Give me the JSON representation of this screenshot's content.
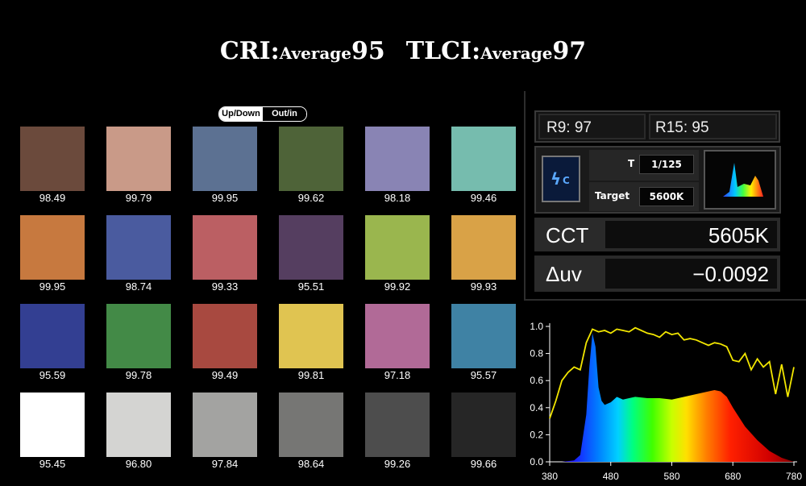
{
  "title": {
    "cri_label": "CRI:",
    "cri_avg_word": "Average",
    "cri_value": "95",
    "tlci_label": "TLCI:",
    "tlci_avg_word": "Average",
    "tlci_value": "97"
  },
  "toggle": {
    "left": "Up/Down",
    "right": "Out/in"
  },
  "swatches": [
    {
      "color": "#6b4a3c",
      "value": "98.49"
    },
    {
      "color": "#c99a88",
      "value": "99.79"
    },
    {
      "color": "#5c7192",
      "value": "99.95"
    },
    {
      "color": "#4e6338",
      "value": "99.62"
    },
    {
      "color": "#8984b4",
      "value": "98.18"
    },
    {
      "color": "#76bcae",
      "value": "99.46"
    },
    {
      "color": "#c7793f",
      "value": "99.95"
    },
    {
      "color": "#4a5b9f",
      "value": "98.74"
    },
    {
      "color": "#bb5f63",
      "value": "99.33"
    },
    {
      "color": "#553e60",
      "value": "95.51"
    },
    {
      "color": "#9ab64e",
      "value": "99.92"
    },
    {
      "color": "#d9a247",
      "value": "99.93"
    },
    {
      "color": "#333f92",
      "value": "95.59"
    },
    {
      "color": "#438a47",
      "value": "99.78"
    },
    {
      "color": "#a84940",
      "value": "99.49"
    },
    {
      "color": "#e0c451",
      "value": "99.81"
    },
    {
      "color": "#b16a97",
      "value": "97.18"
    },
    {
      "color": "#3f82a4",
      "value": "95.57"
    },
    {
      "color": "#ffffff",
      "value": "95.45"
    },
    {
      "color": "#d4d4d2",
      "value": "96.80"
    },
    {
      "color": "#a3a3a1",
      "value": "97.84"
    },
    {
      "color": "#767674",
      "value": "98.64"
    },
    {
      "color": "#4d4d4d",
      "value": "99.26"
    },
    {
      "color": "#262626",
      "value": "99.66"
    }
  ],
  "meter": {
    "r9": "R9: 97",
    "r15": "R15: 95",
    "mode_icon": "flash-c-icon",
    "t_label": "T",
    "t_value": "1/125",
    "target_label": "Target",
    "target_value": "5600K",
    "spectrum_icon": "spectrum-thumbnail-icon",
    "cct_label": "CCT",
    "cct_value": "5605K",
    "duv_label": "Δuv",
    "duv_value": "−0.0092"
  },
  "chart_data": {
    "type": "area",
    "x_ticks": [
      "380",
      "480",
      "580",
      "680",
      "780"
    ],
    "y_ticks": [
      "0.0",
      "0.2",
      "0.4",
      "0.6",
      "0.8",
      "1.0"
    ],
    "xlim": [
      380,
      780
    ],
    "ylim": [
      0,
      1.0
    ],
    "series": [
      {
        "kind": "spectral-power-area",
        "x": [
          380,
          400,
          420,
          430,
          440,
          445,
          450,
          455,
          460,
          465,
          470,
          480,
          490,
          500,
          510,
          520,
          540,
          560,
          580,
          600,
          620,
          640,
          650,
          660,
          670,
          680,
          700,
          720,
          740,
          760,
          780
        ],
        "y": [
          0.0,
          0.0,
          0.01,
          0.05,
          0.35,
          0.7,
          0.95,
          0.85,
          0.55,
          0.45,
          0.42,
          0.44,
          0.48,
          0.46,
          0.47,
          0.48,
          0.47,
          0.47,
          0.46,
          0.48,
          0.5,
          0.52,
          0.53,
          0.52,
          0.48,
          0.4,
          0.26,
          0.16,
          0.08,
          0.03,
          0.0
        ]
      },
      {
        "kind": "line",
        "color": "#f2e600",
        "x": [
          380,
          390,
          400,
          410,
          420,
          430,
          440,
          450,
          460,
          470,
          480,
          490,
          500,
          510,
          520,
          530,
          540,
          550,
          560,
          570,
          580,
          590,
          600,
          610,
          620,
          630,
          640,
          650,
          660,
          670,
          680,
          690,
          700,
          710,
          720,
          730,
          740,
          750,
          760,
          770,
          780
        ],
        "y": [
          0.32,
          0.45,
          0.6,
          0.66,
          0.7,
          0.68,
          0.88,
          0.98,
          0.96,
          0.97,
          0.95,
          0.98,
          0.97,
          0.96,
          0.99,
          0.97,
          0.95,
          0.94,
          0.92,
          0.96,
          0.94,
          0.95,
          0.9,
          0.91,
          0.9,
          0.88,
          0.86,
          0.88,
          0.87,
          0.85,
          0.75,
          0.74,
          0.8,
          0.68,
          0.76,
          0.7,
          0.74,
          0.5,
          0.72,
          0.48,
          0.7
        ]
      }
    ]
  }
}
